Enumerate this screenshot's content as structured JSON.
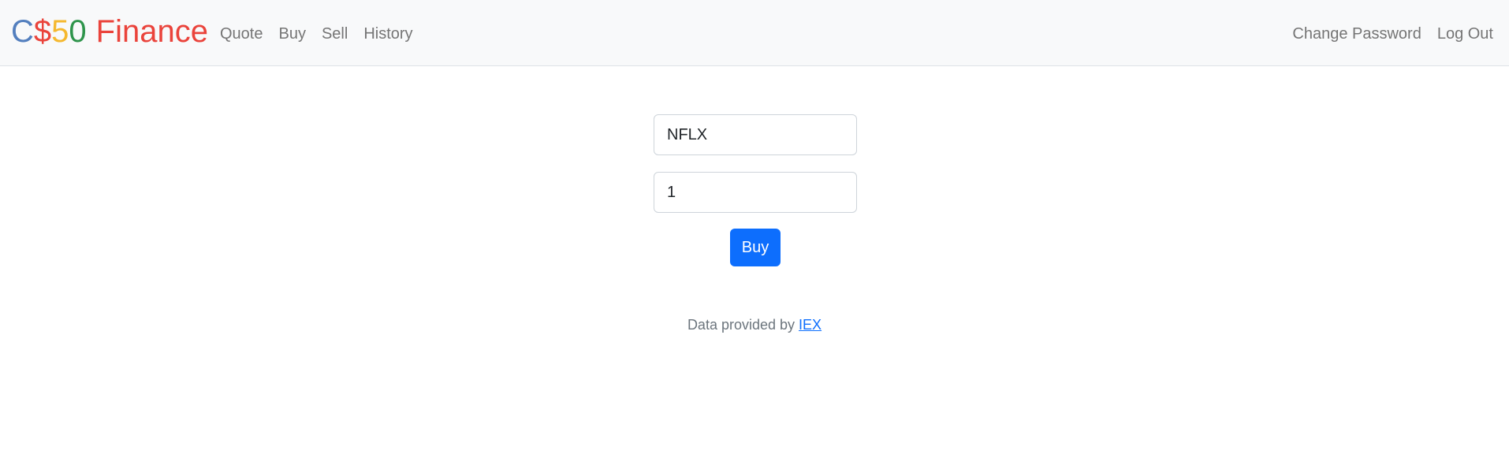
{
  "brand": {
    "c": "C",
    "dollar": "$",
    "five": "5",
    "zero": "0",
    "finance": "Finance",
    "colors": {
      "c": "#537fbe",
      "dollar": "#ea433b",
      "five": "#f5b82e",
      "zero": "#2e944b",
      "finance": "#ea433b"
    }
  },
  "nav": {
    "left": [
      "Quote",
      "Buy",
      "Sell",
      "History"
    ],
    "right": [
      "Change Password",
      "Log Out"
    ]
  },
  "form": {
    "symbol_value": "NFLX",
    "shares_value": "1",
    "submit_label": "Buy"
  },
  "footer": {
    "prefix": "Data provided by",
    "link_text": "IEX"
  },
  "colors": {
    "navbar_bg": "#f8f9fa",
    "primary": "#0d6efd",
    "nav_link": "#757575",
    "footer_text": "#6c757d"
  }
}
